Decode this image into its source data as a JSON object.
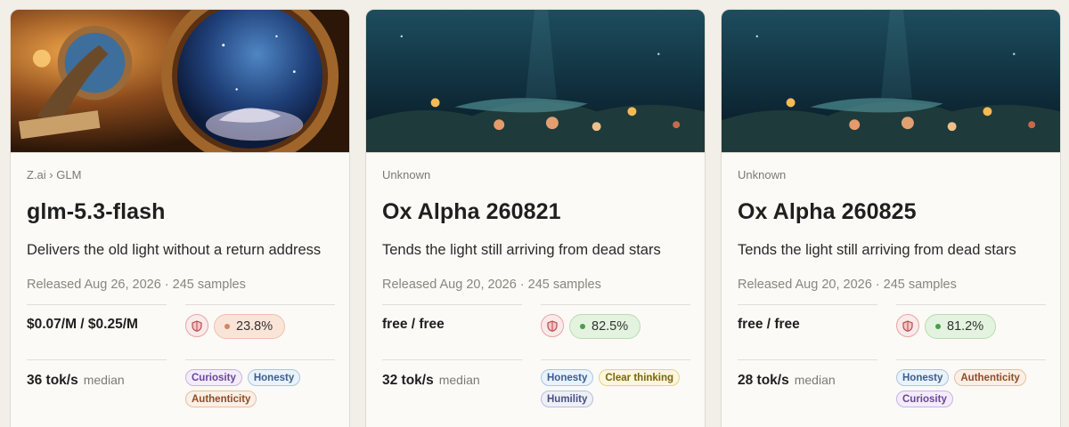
{
  "cards": [
    {
      "breadcrumb": "Z.ai › GLM",
      "title": "glm-5.3-flash",
      "description": "Delivers the old light without a return address",
      "meta": "Released Aug 26, 2026 · 245 samples",
      "price": "$0.07/M / $0.25/M",
      "score": "23.8%",
      "score_level": "warm",
      "speed": "36 tok/s",
      "speed_suffix": "median",
      "tags": [
        "Curiosity",
        "Honesty",
        "Authenticity"
      ],
      "image": "porthole-underwater-scene"
    },
    {
      "breadcrumb": "Unknown",
      "title": "Ox Alpha 260821",
      "description": "Tends the light still arriving from dead stars",
      "meta": "Released Aug 20, 2026 · 245 samples",
      "price": "free / free",
      "score": "82.5%",
      "score_level": "good",
      "speed": "32 tok/s",
      "speed_suffix": "median",
      "tags": [
        "Honesty",
        "Clear thinking",
        "Humility"
      ],
      "image": "deep-sea-reef-scene"
    },
    {
      "breadcrumb": "Unknown",
      "title": "Ox Alpha 260825",
      "description": "Tends the light still arriving from dead stars",
      "meta": "Released Aug 20, 2026 · 245 samples",
      "price": "free / free",
      "score": "81.2%",
      "score_level": "good",
      "speed": "28 tok/s",
      "speed_suffix": "median",
      "tags": [
        "Honesty",
        "Authenticity",
        "Curiosity"
      ],
      "image": "deep-sea-reef-scene"
    }
  ],
  "icons": {
    "shield": "shield-icon",
    "status": "status-dot-icon"
  },
  "colors": {
    "card_bg": "#fbfaf6",
    "page_bg": "#f2efe9",
    "score_good": "#4c9c4c",
    "score_warm": "#d48560"
  }
}
